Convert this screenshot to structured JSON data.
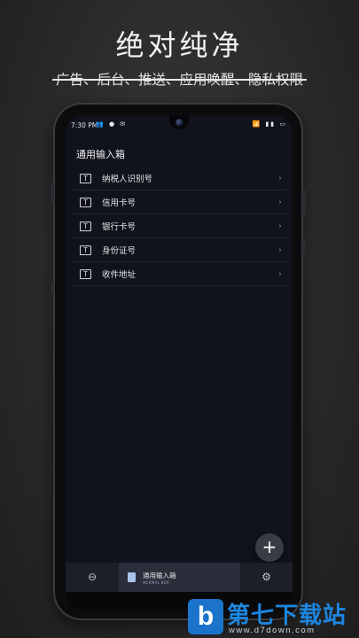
{
  "promo": {
    "headline": "绝对纯净",
    "subheadline": "广告、后台、推送、应用唤醒、隐私权限"
  },
  "status_bar": {
    "time": "7:30 PM",
    "left_icons": "👥 ● ✉",
    "right_icons": "📶 ▮▮ ▭"
  },
  "app": {
    "title": "通用输入箱",
    "items": [
      {
        "icon": "T",
        "label": "纳税人识别号"
      },
      {
        "icon": "T",
        "label": "信用卡号"
      },
      {
        "icon": "T",
        "label": "银行卡号"
      },
      {
        "icon": "T",
        "label": "身份证号"
      },
      {
        "icon": "T",
        "label": "收件地址"
      }
    ],
    "chevron": "›",
    "fab_label": "+"
  },
  "bottom_nav": {
    "left_icon": "⊖",
    "active_title": "通用输入箱",
    "active_subtitle": "NORMAL BOX",
    "right_icon": "⚙"
  },
  "watermark": {
    "logo_letter": "b",
    "title": "第七下载站",
    "url": "www.d7down.com"
  },
  "colors": {
    "background": "#2a2a2a",
    "screen": "#10121c",
    "nav_active": "#2a2d3a",
    "watermark_blue": "#1c86e0"
  }
}
